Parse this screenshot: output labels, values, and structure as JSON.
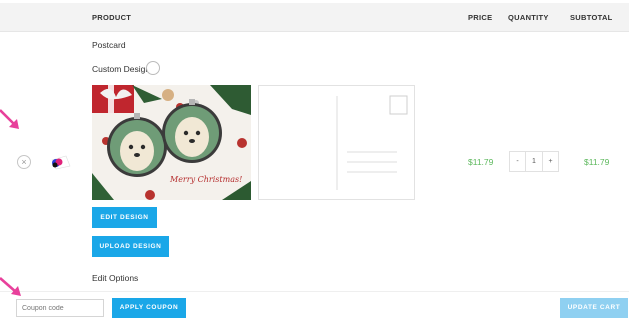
{
  "table": {
    "headers": {
      "product": "PRODUCT",
      "price": "PRICE",
      "quantity": "QUANTITY",
      "subtotal": "SUBTOTAL"
    }
  },
  "item": {
    "name": "Postcard",
    "option_label": "Custom Design",
    "design_image_text": "Merry Christmas!",
    "edit_design_label": "EDIT DESIGN",
    "upload_design_label": "UPLOAD DESIGN",
    "edit_options_label": "Edit Options",
    "price": "$11.79",
    "quantity": "1",
    "qty_decrement": "-",
    "qty_increment": "+",
    "subtotal": "$11.79",
    "remove_symbol": "×"
  },
  "coupon": {
    "placeholder": "Coupon code",
    "apply_label": "APPLY COUPON"
  },
  "cart": {
    "update_label": "UPDATE CART"
  },
  "colors": {
    "accent": "#1aa7e8",
    "price": "#5cb85c",
    "arrow": "#e8409b"
  },
  "icons": [
    "remove-icon",
    "info-icon",
    "cart-thumbnail-icon",
    "annotation-arrow"
  ]
}
